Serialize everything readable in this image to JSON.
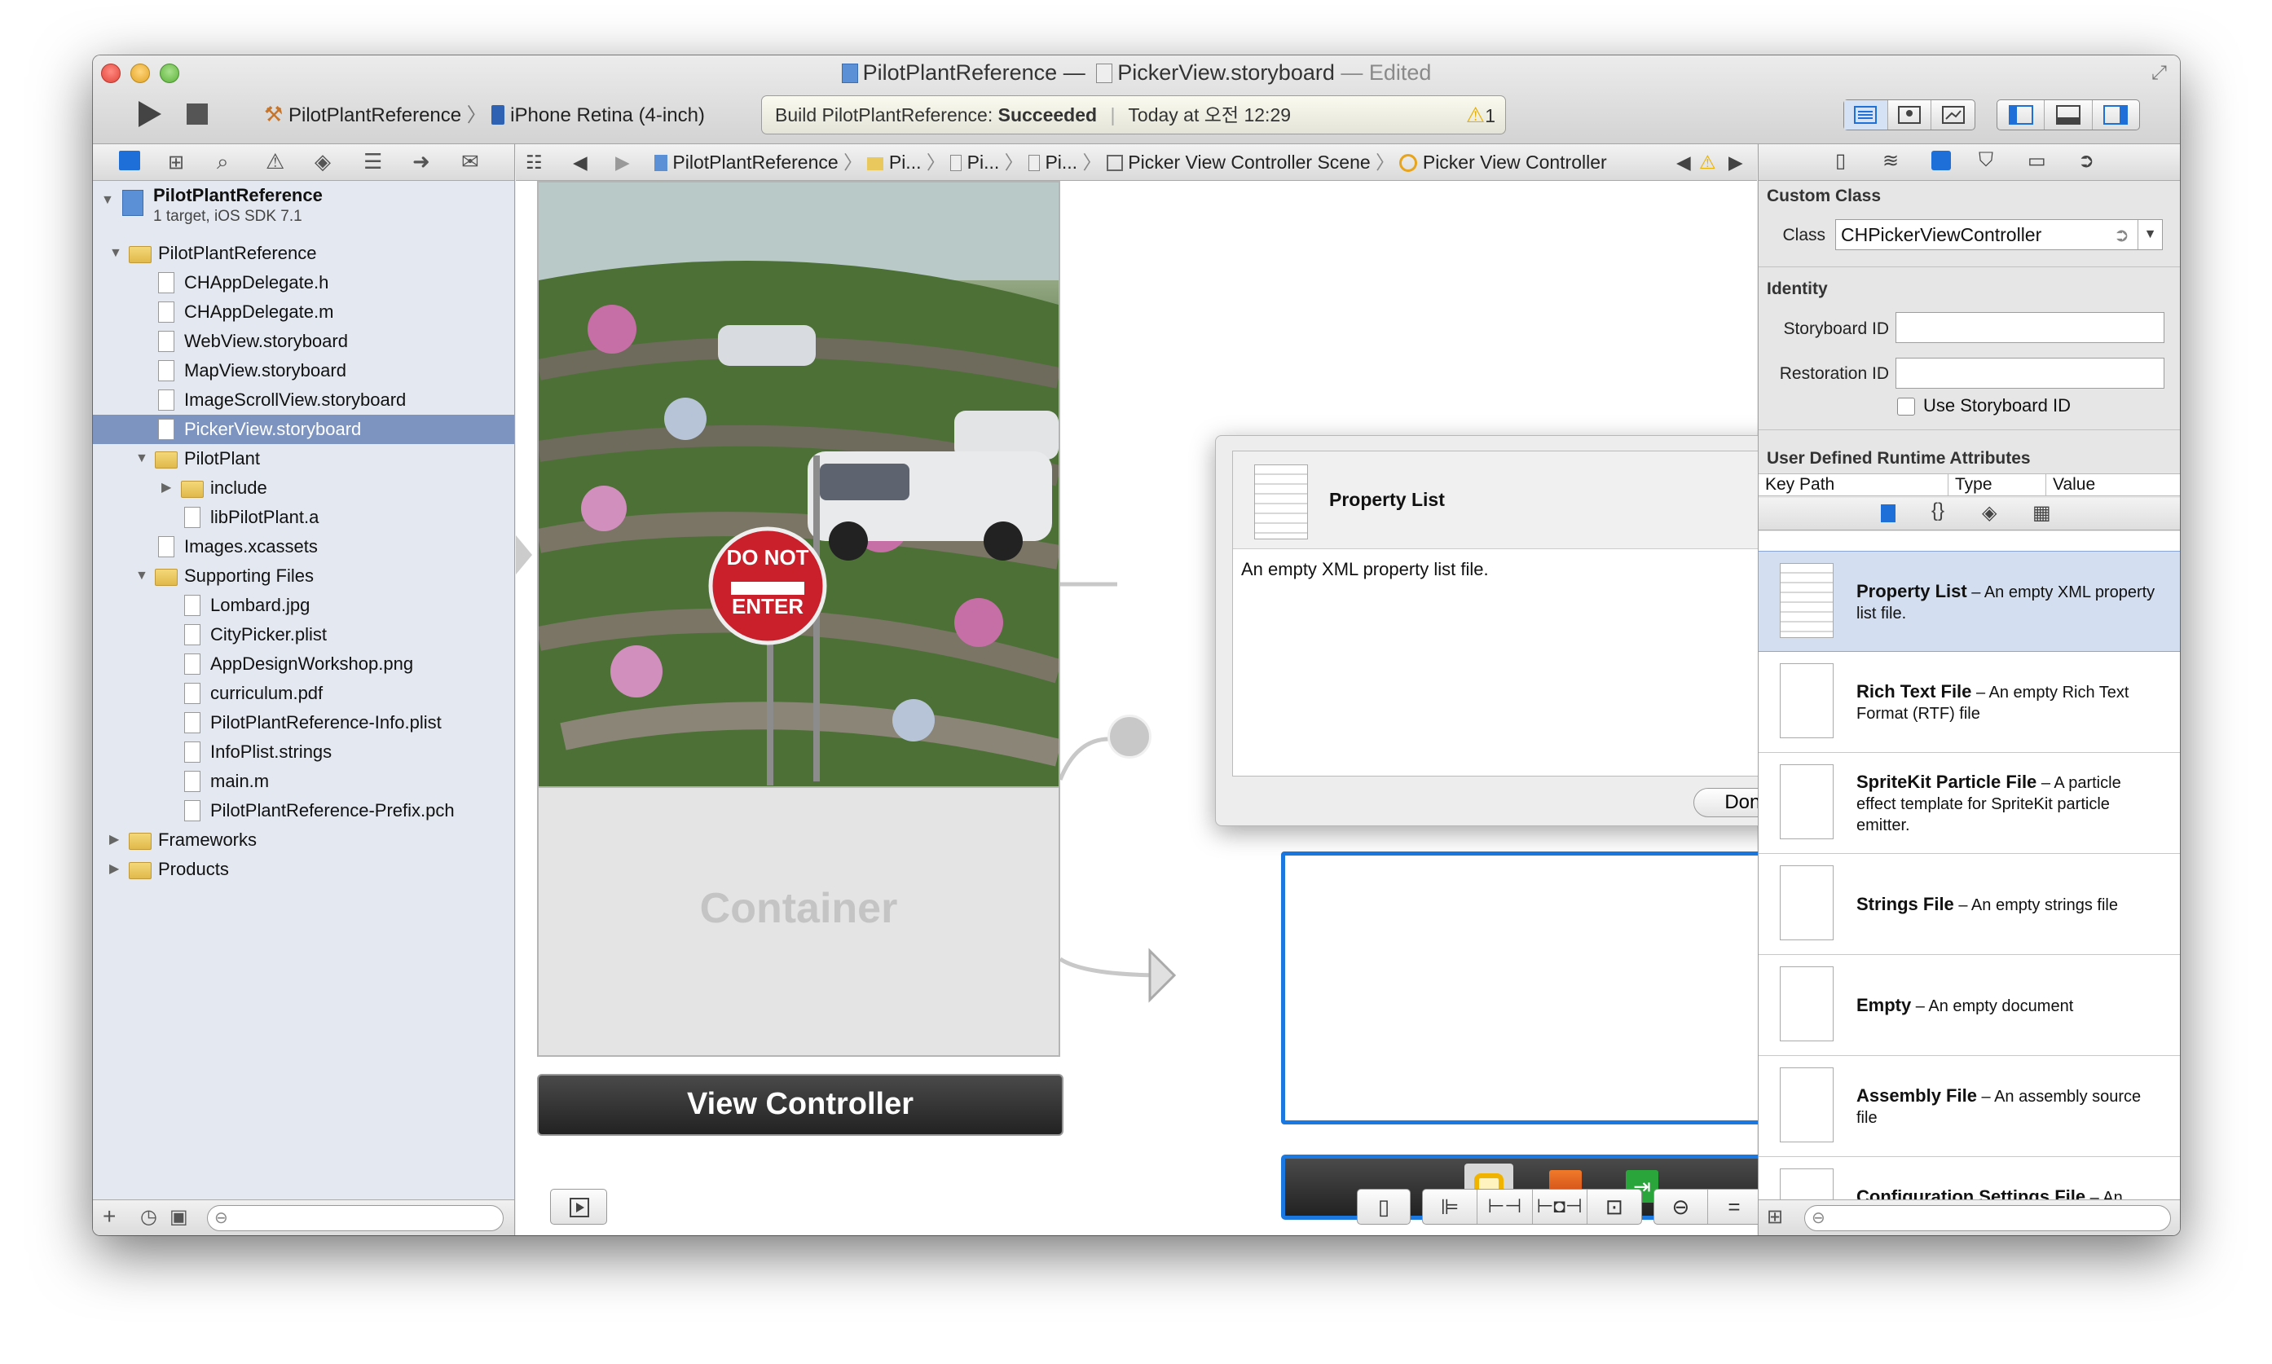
{
  "window": {
    "title_project": "PilotPlantReference",
    "title_sep": "—",
    "title_file": "PickerView.storyboard",
    "title_edited": "— Edited"
  },
  "toolbar": {
    "scheme_project": "PilotPlantReference",
    "scheme_device": "iPhone Retina (4-inch)",
    "status_build": "Build PilotPlantReference:",
    "status_result": "Succeeded",
    "status_time": "Today at 오전 12:29",
    "warning_count": "1"
  },
  "navigator": {
    "project_name": "PilotPlantReference",
    "project_subtitle": "1 target, iOS SDK 7.1",
    "items": [
      {
        "label": "PilotPlantReference",
        "kind": "group",
        "open": true
      },
      {
        "label": "CHAppDelegate.h",
        "kind": "file"
      },
      {
        "label": "CHAppDelegate.m",
        "kind": "file"
      },
      {
        "label": "WebView.storyboard",
        "kind": "file"
      },
      {
        "label": "MapView.storyboard",
        "kind": "file"
      },
      {
        "label": "ImageScrollView.storyboard",
        "kind": "file"
      },
      {
        "label": "PickerView.storyboard",
        "kind": "file",
        "selected": true
      },
      {
        "label": "PilotPlant",
        "kind": "group",
        "open": true
      },
      {
        "label": "include",
        "kind": "group",
        "open": false
      },
      {
        "label": "libPilotPlant.a",
        "kind": "file"
      },
      {
        "label": "Images.xcassets",
        "kind": "file"
      },
      {
        "label": "Supporting Files",
        "kind": "group",
        "open": true
      },
      {
        "label": "Lombard.jpg",
        "kind": "file"
      },
      {
        "label": "CityPicker.plist",
        "kind": "file"
      },
      {
        "label": "AppDesignWorkshop.png",
        "kind": "file"
      },
      {
        "label": "curriculum.pdf",
        "kind": "file"
      },
      {
        "label": "PilotPlantReference-Info.plist",
        "kind": "file"
      },
      {
        "label": "InfoPlist.strings",
        "kind": "file"
      },
      {
        "label": "main.m",
        "kind": "file"
      },
      {
        "label": "PilotPlantReference-Prefix.pch",
        "kind": "file"
      },
      {
        "label": "Frameworks",
        "kind": "group",
        "open": false
      },
      {
        "label": "Products",
        "kind": "group",
        "open": false
      }
    ]
  },
  "jumpbar": {
    "c1": "PilotPlantReference",
    "c2": "Pi...",
    "c3": "Pi...",
    "c4": "Pi...",
    "c5": "Picker View Controller Scene",
    "c6": "Picker View Controller"
  },
  "canvas": {
    "container_label": "Container",
    "vc_label": "View Controller",
    "sign_line1": "DO NOT",
    "sign_line2": "ENTER"
  },
  "popover": {
    "title": "Property List",
    "description": "An empty XML property list file.",
    "done_label": "Done"
  },
  "inspector": {
    "custom_class_header": "Custom Class",
    "class_label": "Class",
    "class_value": "CHPickerViewController",
    "identity_header": "Identity",
    "storyboard_id_label": "Storyboard ID",
    "storyboard_id_value": "",
    "restoration_id_label": "Restoration ID",
    "restoration_id_value": "",
    "use_storyboard_id_label": "Use Storyboard ID",
    "runtime_header": "User Defined Runtime Attributes",
    "col_keypath": "Key Path",
    "col_type": "Type",
    "col_value": "Value"
  },
  "library": [
    {
      "title": "Property List",
      "desc": " – An empty XML property list file.",
      "icon": "plist-file-icon"
    },
    {
      "title": "Rich Text File",
      "desc": " – An empty Rich Text Format (RTF) file",
      "icon": "rtf-file-icon"
    },
    {
      "title": "SpriteKit Particle File",
      "desc": " – A particle effect template for SpriteKit particle emitter.",
      "icon": "sprite-file-icon"
    },
    {
      "title": "Strings File",
      "desc": " – An empty strings file",
      "icon": "strings-file-icon"
    },
    {
      "title": "Empty",
      "desc": " – An empty document",
      "icon": "empty-file-icon"
    },
    {
      "title": "Assembly File",
      "desc": " – An assembly source file",
      "icon": "assembly-file-icon"
    },
    {
      "title": "Configuration Settings File",
      "desc": " – An empty Xcode configuration settings",
      "icon": "config-file-icon"
    }
  ],
  "colors": {
    "selection": "#7c94bf",
    "library_selection": "#d3dff0",
    "canvas_selection": "#1a78e0",
    "warning": "#e8b100"
  }
}
